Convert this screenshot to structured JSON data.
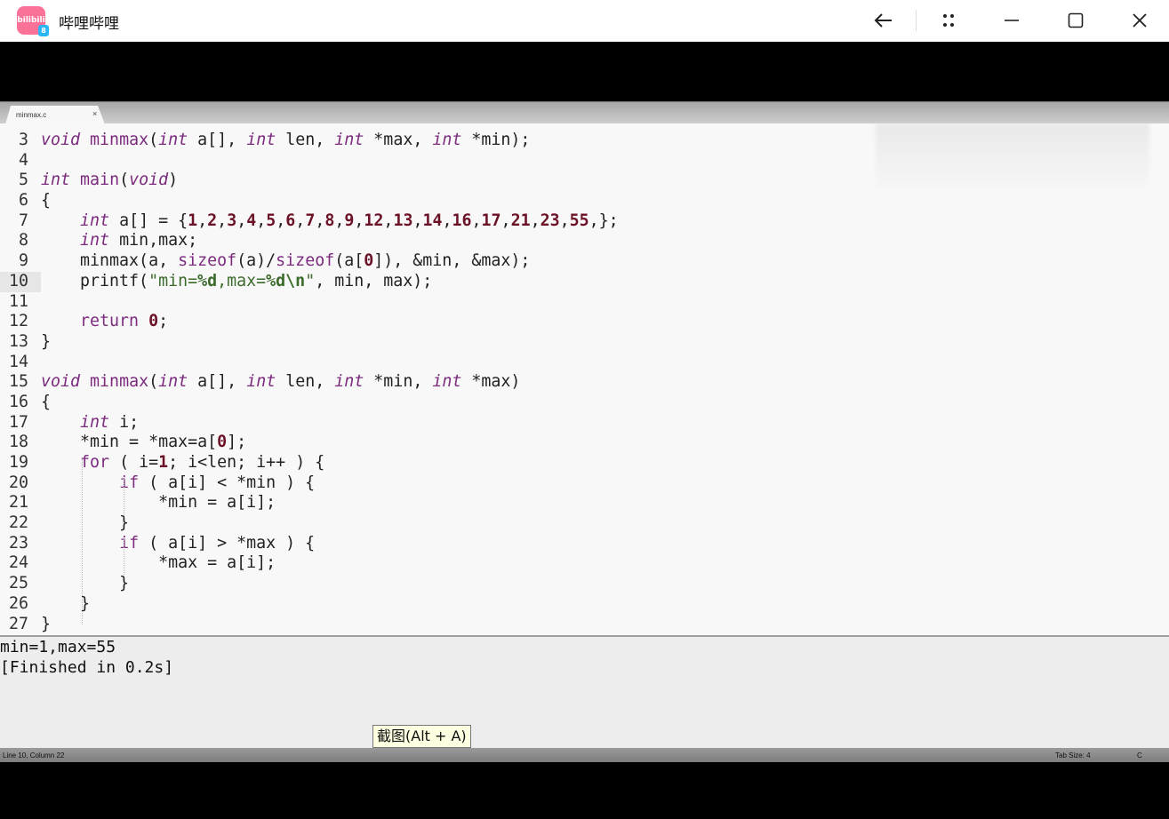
{
  "window": {
    "app_title": "哔哩哔哩",
    "logo_text": "bilibili",
    "logo_badge": "8"
  },
  "editor": {
    "tab_name": "minmax.c",
    "tab_close": "×"
  },
  "code_lines": [
    {
      "n": "3",
      "html": "<span class=\"kt\">void</span> <span class=\"fn\">minmax</span>(<span class=\"kt\">int</span> a[], <span class=\"kt\">int</span> len, <span class=\"kt\">int</span> *max, <span class=\"kt\">int</span> *min);"
    },
    {
      "n": "4",
      "html": ""
    },
    {
      "n": "5",
      "html": "<span class=\"kt\">int</span> <span class=\"fn\">main</span>(<span class=\"kt\">void</span>)"
    },
    {
      "n": "6",
      "html": "{"
    },
    {
      "n": "7",
      "html": "    <span class=\"kt\">int</span> a[] = {<span class=\"num\">1</span>,<span class=\"num\">2</span>,<span class=\"num\">3</span>,<span class=\"num\">4</span>,<span class=\"num\">5</span>,<span class=\"num\">6</span>,<span class=\"num\">7</span>,<span class=\"num\">8</span>,<span class=\"num\">9</span>,<span class=\"num\">12</span>,<span class=\"num\">13</span>,<span class=\"num\">14</span>,<span class=\"num\">16</span>,<span class=\"num\">17</span>,<span class=\"num\">21</span>,<span class=\"num\">23</span>,<span class=\"num\">55</span>,};"
    },
    {
      "n": "8",
      "html": "    <span class=\"kt\">int</span> min,max;"
    },
    {
      "n": "9",
      "html": "    minmax(a, <span class=\"fn\">sizeof</span>(a)/<span class=\"fn\">sizeof</span>(a[<span class=\"num\">0</span>]), &amp;min, &amp;max);"
    },
    {
      "n": "10",
      "html": "    printf(<span class=\"str\">\"min=<b>%d</b>,max=<b>%d</b><b>\\n</b>\"</span>, min, max);",
      "current": true
    },
    {
      "n": "11",
      "html": ""
    },
    {
      "n": "12",
      "html": "    <span class=\"kw\">return</span> <span class=\"num\">0</span>;"
    },
    {
      "n": "13",
      "html": "}"
    },
    {
      "n": "14",
      "html": ""
    },
    {
      "n": "15",
      "html": "<span class=\"kt\">void</span> <span class=\"fn\">minmax</span>(<span class=\"kt\">int</span> a[], <span class=\"kt\">int</span> len, <span class=\"kt\">int</span> *min, <span class=\"kt\">int</span> *max)"
    },
    {
      "n": "16",
      "html": "{"
    },
    {
      "n": "17",
      "html": "    <span class=\"kt\">int</span> i;"
    },
    {
      "n": "18",
      "html": "    *min = *max=a[<span class=\"num\">0</span>];"
    },
    {
      "n": "19",
      "html": "    <span class=\"kw\">for</span> ( i=<span class=\"num\">1</span>; i&lt;len; i++ ) {"
    },
    {
      "n": "20",
      "html": "        <span class=\"kw\">if</span> ( a[i] &lt; *min ) {"
    },
    {
      "n": "21",
      "html": "            *min = a[i];"
    },
    {
      "n": "22",
      "html": "        }"
    },
    {
      "n": "23",
      "html": "        <span class=\"kw\">if</span> ( a[i] &gt; *max ) {"
    },
    {
      "n": "24",
      "html": "            *max = a[i];"
    },
    {
      "n": "25",
      "html": "        }"
    },
    {
      "n": "26",
      "html": "    }"
    },
    {
      "n": "27",
      "html": "}"
    }
  ],
  "console": {
    "line1": "min=1,max=55",
    "line2": "[Finished in 0.2s]"
  },
  "tooltip": "截图(Alt + A)",
  "status": {
    "position": "Line 10, Column 22",
    "tab_size": "Tab Size: 4",
    "syntax": "C"
  }
}
